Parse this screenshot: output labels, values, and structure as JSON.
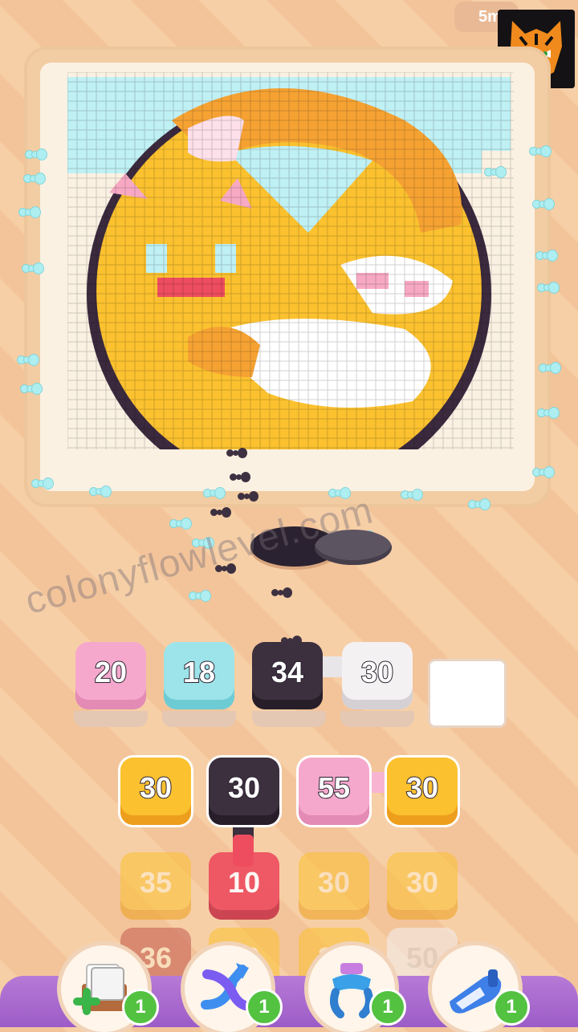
{
  "hud": {
    "timer": "5m"
  },
  "logo": {
    "icon": "tiger-head-icon"
  },
  "watermark": {
    "text": "colonyflowlevel.com"
  },
  "queue_slots": [
    {
      "value": "20",
      "color": "pink"
    },
    {
      "value": "18",
      "color": "cyan"
    },
    {
      "value": "34",
      "color": "dark"
    },
    {
      "value": "30",
      "color": "white"
    },
    {
      "value": "",
      "color": "empty"
    }
  ],
  "grid": {
    "row1": [
      {
        "value": "30",
        "color": "yellow"
      },
      {
        "value": "30",
        "color": "dark"
      },
      {
        "value": "55",
        "color": "pink"
      },
      {
        "value": "30",
        "color": "yellow"
      }
    ],
    "row2": [
      {
        "value": "35",
        "color": "yellow"
      },
      {
        "value": "10",
        "color": "red"
      },
      {
        "value": "30",
        "color": "yellow"
      },
      {
        "value": "30",
        "color": "yellow"
      }
    ],
    "row3": [
      {
        "value": "36",
        "color": "red"
      },
      {
        "value": "40",
        "color": "yellow"
      },
      {
        "value": "30",
        "color": "yellow"
      },
      {
        "value": "50",
        "color": "white"
      }
    ]
  },
  "boosters": [
    {
      "icon": "add-cards-icon",
      "count": "1"
    },
    {
      "icon": "shuffle-arrows-icon",
      "count": "1"
    },
    {
      "icon": "magnet-claw-icon",
      "count": "1"
    },
    {
      "icon": "vacuum-icon",
      "count": "1"
    }
  ],
  "colors": {
    "pixel_yellow": "#fbc12f",
    "pixel_orange": "#f5a233",
    "pixel_outline": "#3b2a3e",
    "pixel_sky": "#bff0f4",
    "pixel_pink": "#f7a9c4",
    "pixel_white": "#ffffff"
  }
}
